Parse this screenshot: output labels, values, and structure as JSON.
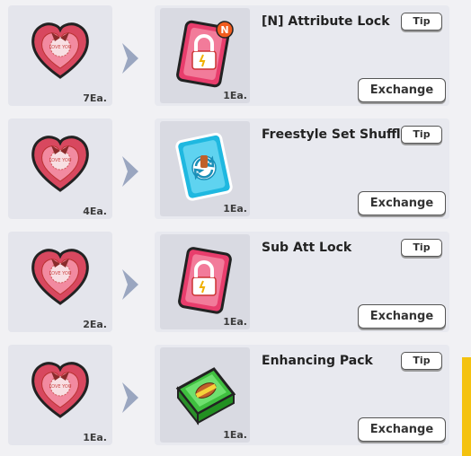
{
  "rows": [
    {
      "src_count": "7Ea.",
      "reward_count": "1Ea.",
      "title": "[N] Attribute Lock",
      "tip": "Tip",
      "exchange": "Exchange",
      "badge": "N"
    },
    {
      "src_count": "4Ea.",
      "reward_count": "1Ea.",
      "title": "Freestyle Set Shuffle",
      "tip": "Tip",
      "exchange": "Exchange"
    },
    {
      "src_count": "2Ea.",
      "reward_count": "1Ea.",
      "title": "Sub Att Lock",
      "tip": "Tip",
      "exchange": "Exchange"
    },
    {
      "src_count": "1Ea.",
      "reward_count": "1Ea.",
      "title": "Enhancing Pack",
      "tip": "Tip",
      "exchange": "Exchange"
    }
  ],
  "heart_text": "LOVE YOU",
  "colors": {
    "accent": "#f4c20f",
    "heart": "#e8506a",
    "lock_card": "#e83d6c",
    "shuffle_card": "#1fb8e0",
    "pack": "#3fbf3f"
  }
}
